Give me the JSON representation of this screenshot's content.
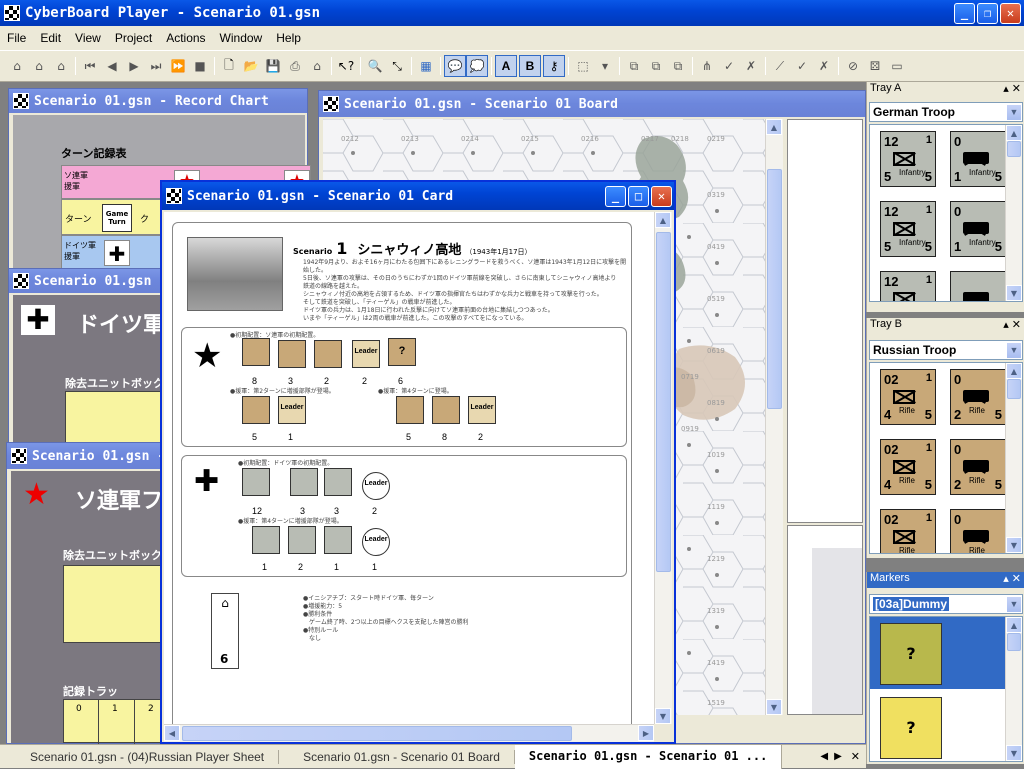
{
  "app": {
    "title": "CyberBoard Player - Scenario 01.gsn"
  },
  "menu": [
    "File",
    "Edit",
    "View",
    "Project",
    "Actions",
    "Window",
    "Help"
  ],
  "toolbar": {
    "text_buttons": [
      "A",
      "B"
    ]
  },
  "windows": {
    "record_chart": {
      "title": "Scenario 01.gsn - Record Chart",
      "heading": "ターン記録表",
      "row1": "ソ連軍\n援軍",
      "row2": "ターン",
      "game_turn": "Game\nTurn",
      "row3": "ドイツ軍\n援軍",
      "cell_k": "ク"
    },
    "german_sheet": {
      "title": "Scenario 01.gsn - ",
      "heading": "ドイツ軍",
      "box_label": "除去ユニットボック"
    },
    "russian_sheet": {
      "title": "Scenario 01.gsn - ",
      "heading": "ソ連軍フ",
      "box_label": "除去ユニットボック",
      "record_label": "記録トラッ",
      "track": [
        "0",
        "1",
        "2"
      ]
    },
    "board": {
      "title": "Scenario 01.gsn - Scenario 01 Board",
      "hex_labels": [
        "0212",
        "0213",
        "0214",
        "0215",
        "0216",
        "0217",
        "0218",
        "0219",
        "0319",
        "0419",
        "0519",
        "0619",
        "0719",
        "0819",
        "0919",
        "1019",
        "1119",
        "1219",
        "1319",
        "1419",
        "1519"
      ]
    },
    "card": {
      "title": "Scenario 01.gsn - Scenario 01 Card",
      "scenario_word": "Scenario",
      "scenario_num": "1",
      "scenario_title": "シニャウィノ高地",
      "scenario_date": "（1943年1月17日）",
      "intro_lines": [
        "1942年9月より、およそ16ヶ月にわたる包囲下にあるレニングラードを救うべく、ソ連軍は1943年1月12日に攻撃を開始した。",
        "5日後、ソ連軍の攻撃は、その日のうちにわずか1回のドイツ軍前線を突破し、さらに南東してシニャウィノ高地より",
        "鉄道の線路を越えた。",
        "シニャウィノ付近の高地を占領するため、ドイツ軍の指揮官たちはわずかな兵力と戦車を持って攻撃を行った。",
        "そして鉄道を突破し、「ティーゲル」の戦車が前進した。",
        "ドイツ軍の兵力は、1月18日に行われた反撃に向けてソ連軍前面の台地に集結しつつあった。",
        "いまや「ティーゲル」は2両の戦車が前進した。この攻撃のすべてをになっている。"
      ],
      "soviet_line1": "●初期配置：ソ連軍の初期配置。",
      "soviet_line2": "●援軍：第2ターンに増援部隊が登場。",
      "soviet_line3": "●援軍：第4ターンに登場。",
      "soviet_counts_a": [
        "8",
        "3",
        "2",
        "2",
        "6"
      ],
      "soviet_counts_b": [
        "5",
        "1"
      ],
      "soviet_counts_c": [
        "5",
        "8",
        "2"
      ],
      "german_line1": "●初期配置：ドイツ軍の初期配置。",
      "german_line2": "●援軍：第4ターンに増援部隊が登場。",
      "german_counts_a": [
        "12",
        "3",
        "3",
        "2"
      ],
      "german_counts_b": [
        "1",
        "2",
        "1",
        "1"
      ],
      "leader_label": "Leader",
      "turn_counter": "6",
      "rules": [
        "●イニシアチブ：スタート時ドイツ軍、毎ターン",
        "●増援能力：5",
        "●勝利条件",
        "　ゲーム終了時、2つ以上の目標ヘクスを支配した陣営の勝利",
        "●特別ルール",
        "　なし"
      ]
    }
  },
  "tray_a": {
    "header": "Tray A",
    "selected": "German Troop",
    "counters": [
      {
        "tl": "12",
        "tr": "1",
        "bl": "5",
        "br": "5",
        "lbl": "Infantry",
        "mid": "3",
        "mid2": "6",
        "type": "inf"
      },
      {
        "tl": "0",
        "tr": "",
        "bl": "1",
        "br": "5",
        "lbl": "Infantry",
        "type": "vehicle"
      },
      {
        "tl": "12",
        "tr": "1",
        "bl": "5",
        "br": "5",
        "lbl": "Infantry",
        "mid": "3",
        "mid2": "6",
        "type": "inf"
      },
      {
        "tl": "0",
        "tr": "",
        "bl": "1",
        "br": "5",
        "lbl": "Infantry",
        "type": "vehicle"
      },
      {
        "tl": "12",
        "tr": "1",
        "bl": "",
        "br": "",
        "lbl": "",
        "type": "inf"
      },
      {
        "tl": "",
        "tr": "",
        "bl": "",
        "br": "",
        "lbl": "",
        "type": "vehicle"
      }
    ]
  },
  "tray_b": {
    "header": "Tray B",
    "selected": "Russian Troop",
    "counters": [
      {
        "tl": "02",
        "tr": "1",
        "bl": "4",
        "br": "5",
        "lbl": "Rifle",
        "mid": "5",
        "mid2": "5",
        "type": "inf"
      },
      {
        "tl": "0",
        "tr": "",
        "bl": "2",
        "br": "5",
        "lbl": "Rifle",
        "type": "vehicle"
      },
      {
        "tl": "02",
        "tr": "1",
        "bl": "4",
        "br": "5",
        "lbl": "Rifle",
        "mid": "5",
        "mid2": "5",
        "type": "inf"
      },
      {
        "tl": "0",
        "tr": "",
        "bl": "2",
        "br": "5",
        "lbl": "Rifle",
        "type": "vehicle"
      },
      {
        "tl": "02",
        "tr": "1",
        "bl": "",
        "br": "",
        "lbl": "Rifle",
        "type": "inf"
      },
      {
        "tl": "0",
        "tr": "",
        "bl": "",
        "br": "",
        "lbl": "Rifle",
        "type": "vehicle"
      }
    ]
  },
  "markers": {
    "header": "Markers",
    "selected": "[03a]Dummy",
    "items": [
      "?",
      "?"
    ]
  },
  "taskbar": [
    "Scenario 01.gsn - (04)Russian Player Sheet",
    "Scenario 01.gsn - Scenario 01 Board",
    "Scenario 01.gsn - Scenario 01 ..."
  ],
  "colors": {
    "tan": "#c8a878",
    "grey": "#b8bcb4",
    "marker_green": "#b8b84c",
    "marker_yellow": "#f0e060",
    "selection": "#316ac5"
  }
}
